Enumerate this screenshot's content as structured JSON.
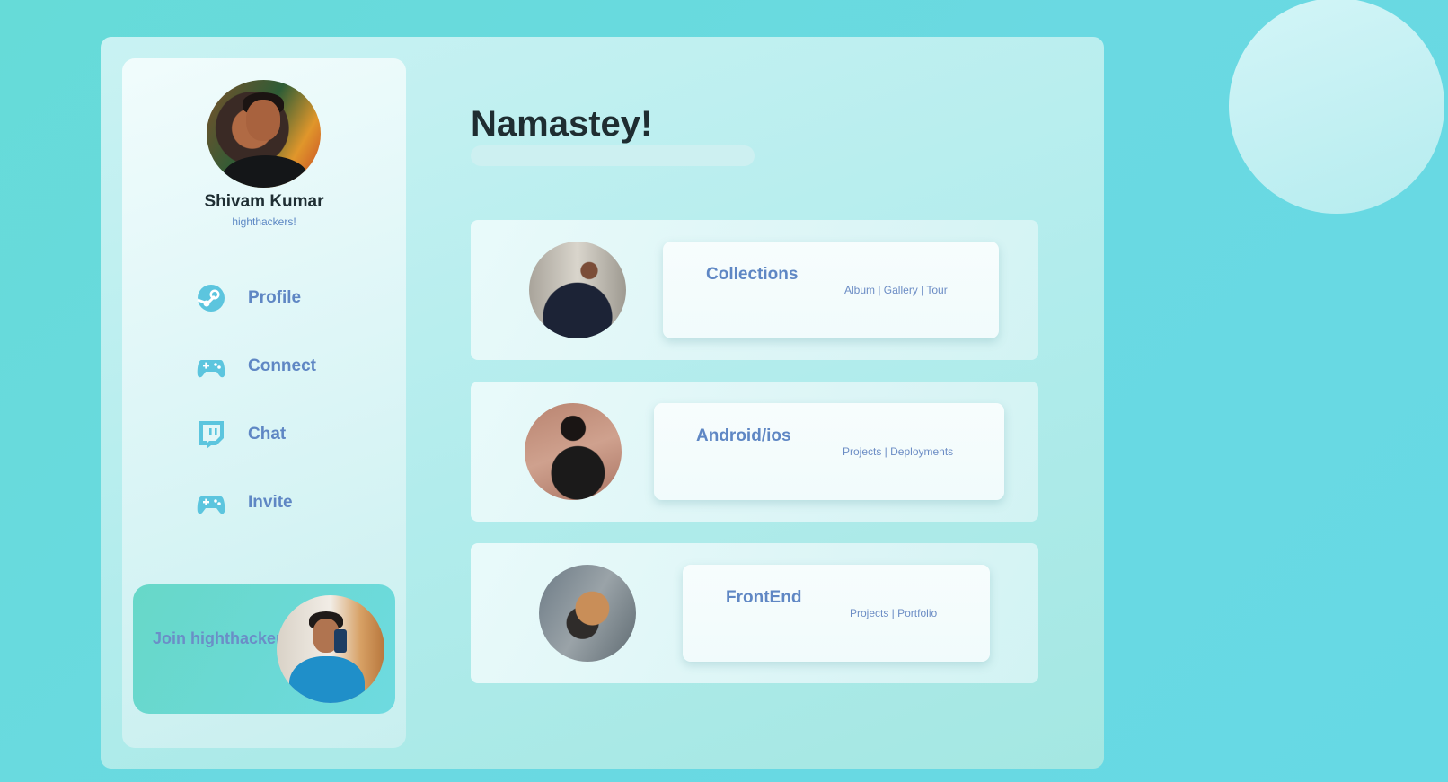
{
  "profile": {
    "name": "Shivam Kumar",
    "handle": "highthackers!"
  },
  "nav": {
    "items": [
      {
        "label": "Profile",
        "icon": "steam-icon"
      },
      {
        "label": "Connect",
        "icon": "gamepad-icon"
      },
      {
        "label": "Chat",
        "icon": "twitch-icon"
      },
      {
        "label": "Invite",
        "icon": "gamepad-icon"
      }
    ]
  },
  "join": {
    "label": "Join highthackers"
  },
  "main": {
    "greeting": "Namastey!",
    "cards": [
      {
        "title": "Collections",
        "subtitle": "Album | Gallery | Tour"
      },
      {
        "title": "Android/ios",
        "subtitle": "Projects | Deployments"
      },
      {
        "title": "FrontEnd",
        "subtitle": "Projects | Portfolio"
      }
    ]
  },
  "colors": {
    "background": "#6ad9e2",
    "accent_text": "#5f87c4",
    "icon": "#5cc5de",
    "heading": "#1f2d31"
  }
}
